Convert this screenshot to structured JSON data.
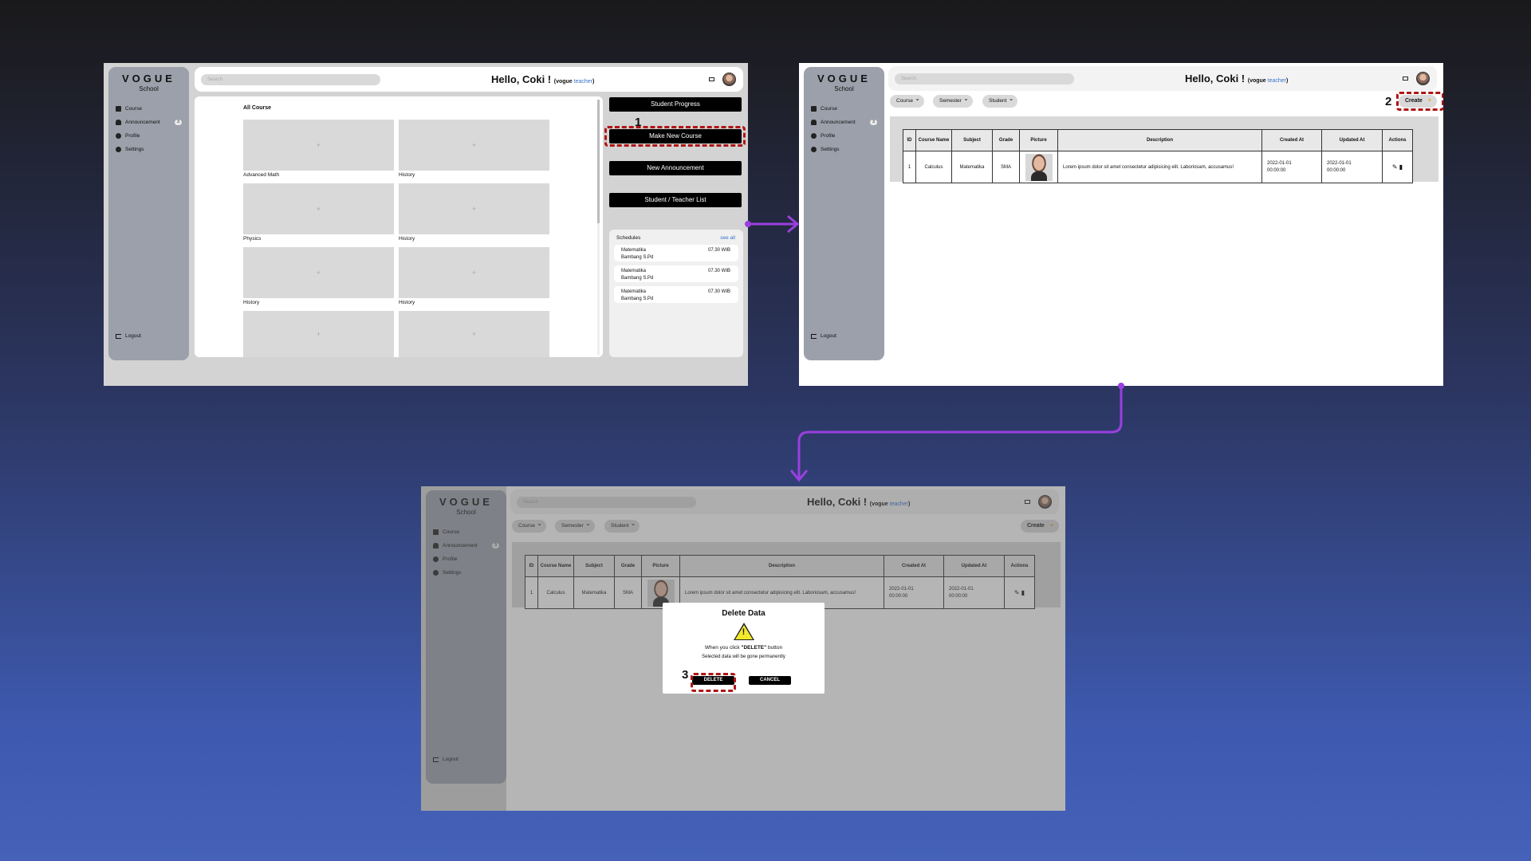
{
  "brand": {
    "title": "VOGUE",
    "subtitle": "School"
  },
  "sidebar": {
    "items": [
      {
        "label": "Course",
        "icon": "book-icon"
      },
      {
        "label": "Announcement",
        "icon": "bell-icon",
        "badge": "3"
      },
      {
        "label": "Profile",
        "icon": "user-icon"
      },
      {
        "label": "Settings",
        "icon": "gear-icon"
      }
    ],
    "logout": "Logout"
  },
  "topbar": {
    "search_placeholder": "Search",
    "greeting": "Hello, Coki !",
    "school": "(vogue",
    "role": "teacher",
    "close_paren": ")"
  },
  "screen1": {
    "section_title": "All Course",
    "courses": [
      "Advanced Math",
      "History",
      "Physics",
      "History",
      "History",
      "History",
      "",
      ""
    ],
    "buttons": [
      "Student Progress",
      "Make New Course",
      "New Announcement",
      "Student / Teacher List"
    ],
    "schedules_title": "Schedules",
    "see_all": "see all",
    "schedules": [
      {
        "subject": "Matematika",
        "teacher": "Bambang S.Pd",
        "time": "07.30 WIB"
      },
      {
        "subject": "Matematika",
        "teacher": "Bambang S.Pd",
        "time": "07.30 WIB"
      },
      {
        "subject": "Matematika",
        "teacher": "Bambang S.Pd",
        "time": "07.30 WIB"
      }
    ],
    "step": "1"
  },
  "screen2": {
    "filters": [
      "Course",
      "Semester",
      "Student"
    ],
    "create": "Create",
    "create_plus": "+",
    "step": "2",
    "table": {
      "headers": [
        "ID",
        "Course Name",
        "Subject",
        "Grade",
        "Picture",
        "Description",
        "Created At",
        "Updated At",
        "Actions"
      ],
      "row": {
        "id": "1",
        "course": "Calculus",
        "subject": "Matematika",
        "grade": "SMA",
        "description": "Lorem ipsum dolor sit amet consectetur adipisicing elit. Laboriosam, accusamus!",
        "created_date": "2022-01-01",
        "created_time": "00:00:00",
        "updated_date": "2022-01-01",
        "updated_time": "00:00:00"
      }
    }
  },
  "screen3": {
    "modal_title": "Delete Data",
    "modal_msg_pre": "When you click ",
    "modal_msg_bold": "\"DELETE\"",
    "modal_msg_post": " button",
    "modal_sub": "Selected data will be gone permanently",
    "delete": "DELETE",
    "cancel": "CANCEL",
    "step": "3"
  },
  "colors": {
    "accent": "#3a70d0",
    "highlight": "#b01515",
    "connector": "#9b3fe0",
    "create_plus": "#e8a02a"
  }
}
